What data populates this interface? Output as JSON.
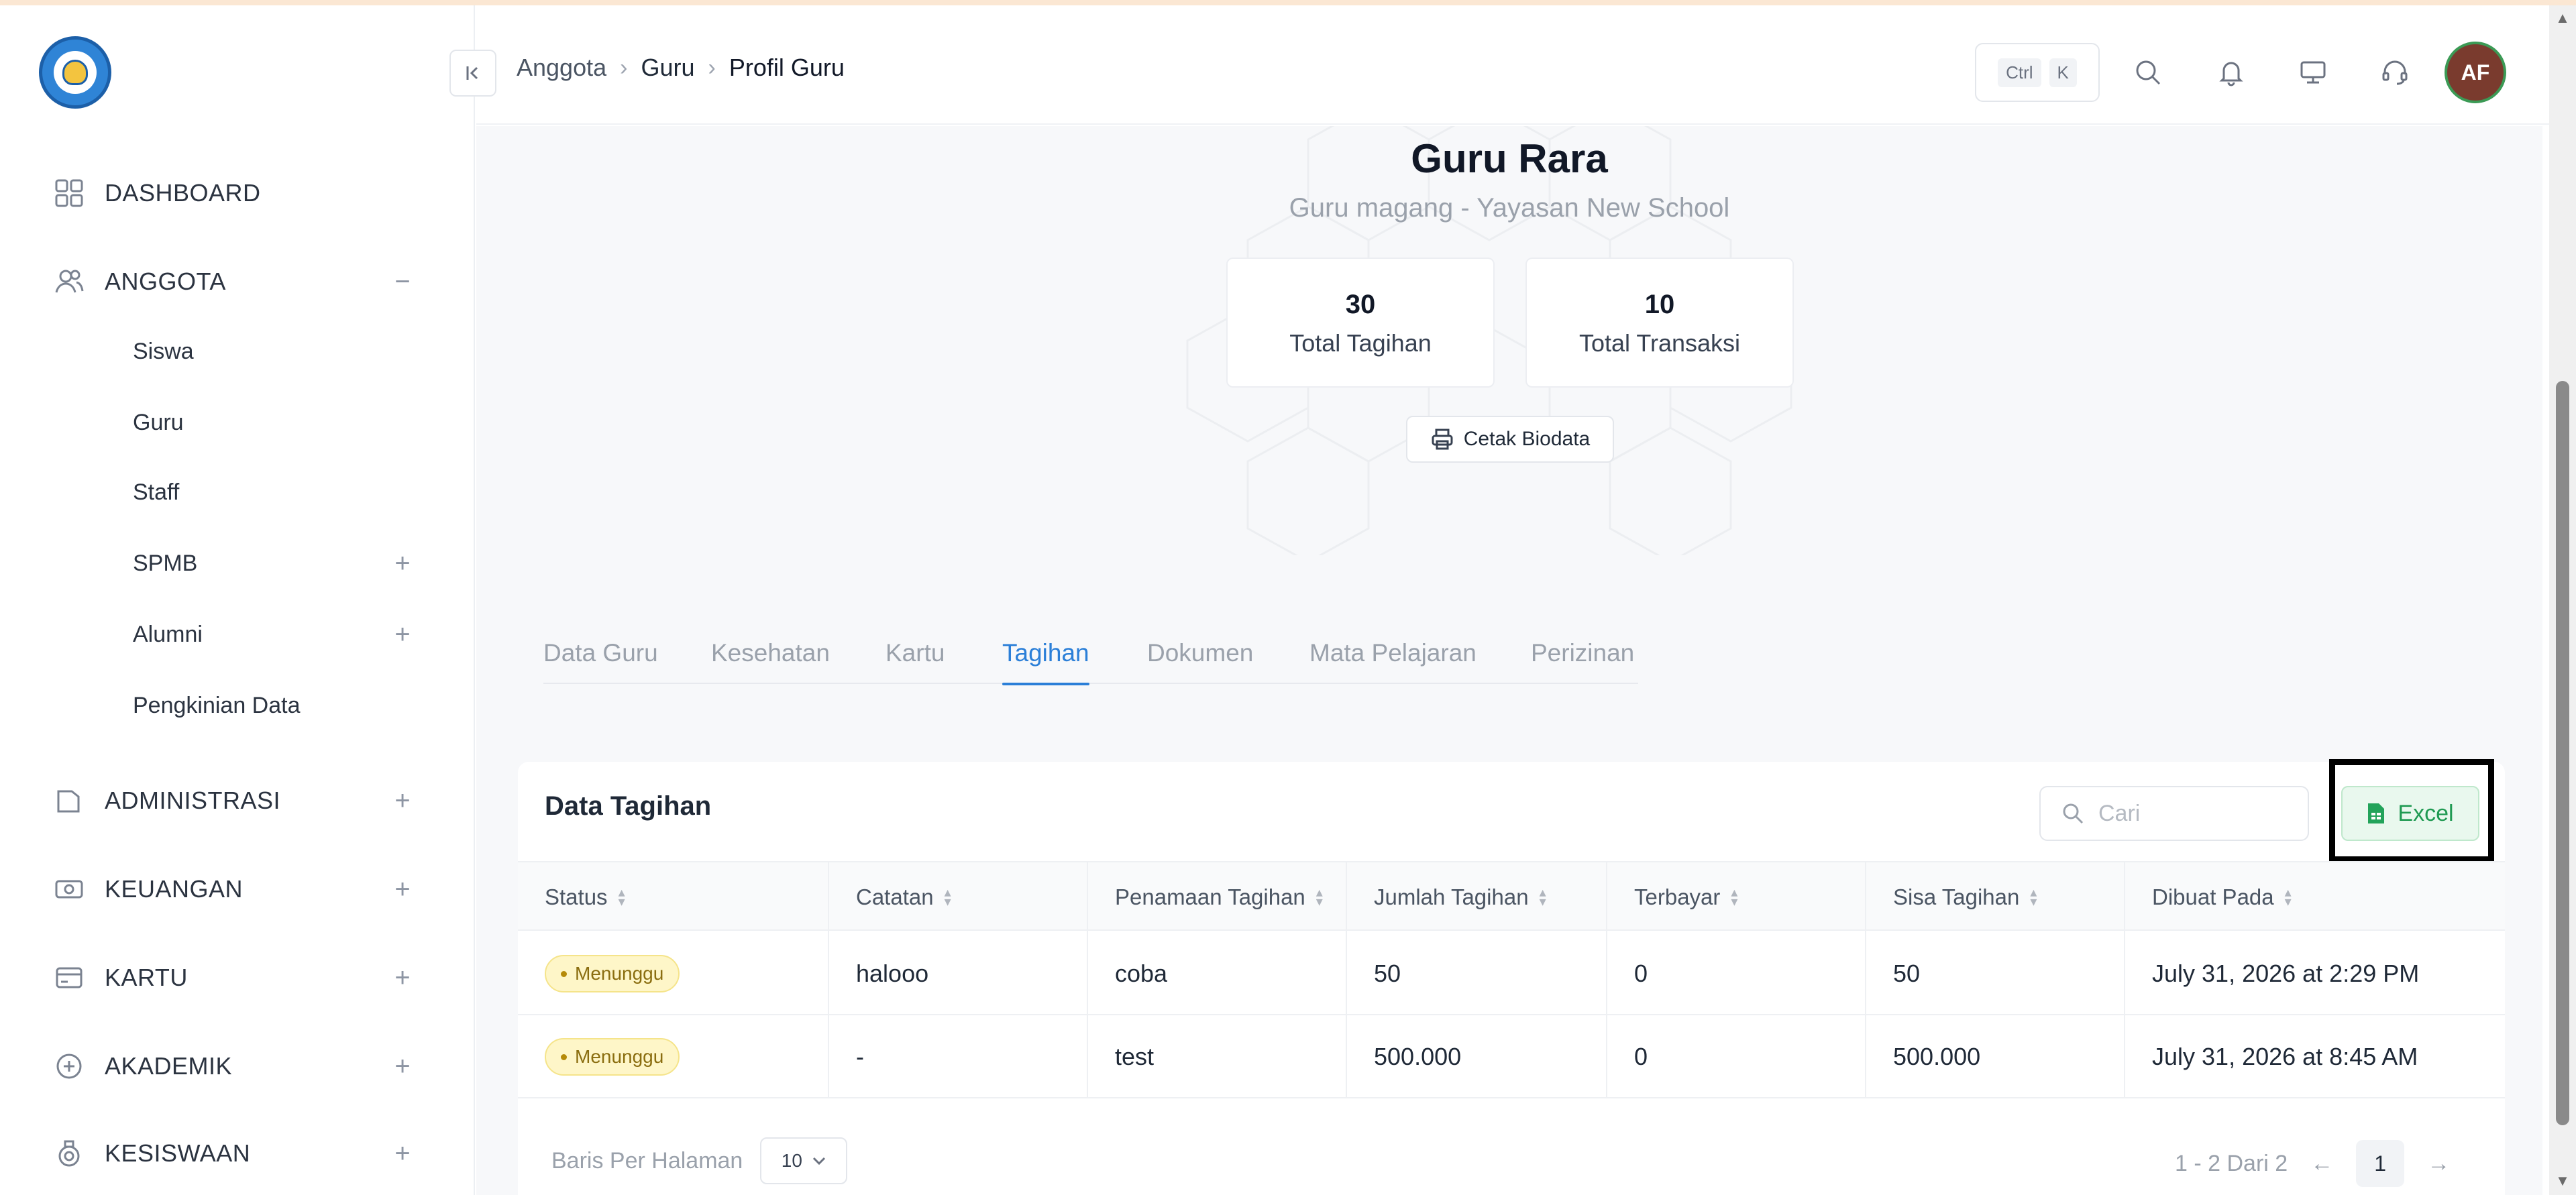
{
  "sidebar": {
    "items": [
      {
        "label": "DASHBOARD",
        "icon": "grid-icon",
        "toggle": ""
      },
      {
        "label": "ANGGOTA",
        "icon": "users-icon",
        "toggle": "−"
      },
      {
        "label": "ADMINISTRASI",
        "icon": "folder-icon",
        "toggle": "+"
      },
      {
        "label": "KEUANGAN",
        "icon": "money-icon",
        "toggle": "+"
      },
      {
        "label": "KARTU",
        "icon": "card-icon",
        "toggle": "+"
      },
      {
        "label": "AKADEMIK",
        "icon": "academic-icon",
        "toggle": "+"
      },
      {
        "label": "KESISWAAN",
        "icon": "student-icon",
        "toggle": "+"
      }
    ],
    "subitems": [
      {
        "label": "Siswa",
        "toggle": ""
      },
      {
        "label": "Guru",
        "toggle": ""
      },
      {
        "label": "Staff",
        "toggle": ""
      },
      {
        "label": "SPMB",
        "toggle": "+"
      },
      {
        "label": "Alumni",
        "toggle": "+"
      },
      {
        "label": "Pengkinian Data",
        "toggle": ""
      }
    ]
  },
  "header": {
    "breadcrumb": [
      "Anggota",
      "Guru",
      "Profil Guru"
    ],
    "shortcut": [
      "Ctrl",
      "K"
    ],
    "avatar_initials": "AF"
  },
  "profile": {
    "name": "Guru Rara",
    "subtitle": "Guru magang - Yayasan New School",
    "stats": [
      {
        "value": "30",
        "label": "Total Tagihan"
      },
      {
        "value": "10",
        "label": "Total Transaksi"
      }
    ],
    "print_label": "Cetak Biodata"
  },
  "tabs": [
    {
      "label": "Data Guru",
      "active": false
    },
    {
      "label": "Kesehatan",
      "active": false
    },
    {
      "label": "Kartu",
      "active": false
    },
    {
      "label": "Tagihan",
      "active": true
    },
    {
      "label": "Dokumen",
      "active": false
    },
    {
      "label": "Mata Pelajaran",
      "active": false
    },
    {
      "label": "Perizinan",
      "active": false
    }
  ],
  "table": {
    "title": "Data Tagihan",
    "search_placeholder": "Cari",
    "excel_label": "Excel",
    "columns": [
      "Status",
      "Catatan",
      "Penamaan Tagihan",
      "Jumlah Tagihan",
      "Terbayar",
      "Sisa Tagihan",
      "Dibuat Pada"
    ],
    "rows": [
      {
        "status": "Menunggu",
        "catatan": "halooo",
        "penamaan": "coba",
        "jumlah": "50",
        "terbayar": "0",
        "sisa": "50",
        "dibuat": "July 31, 2026 at 2:29 PM"
      },
      {
        "status": "Menunggu",
        "catatan": "-",
        "penamaan": "test",
        "jumlah": "500.000",
        "terbayar": "0",
        "sisa": "500.000",
        "dibuat": "July 31, 2026 at 8:45 AM"
      }
    ],
    "per_page_label": "Baris Per Halaman",
    "per_page_value": "10",
    "range_label": "1 - 2 Dari 2",
    "current_page": "1"
  },
  "colors": {
    "accent": "#2b7fd8",
    "excel_green": "#1f9a52",
    "badge_bg": "#fef6c8"
  }
}
